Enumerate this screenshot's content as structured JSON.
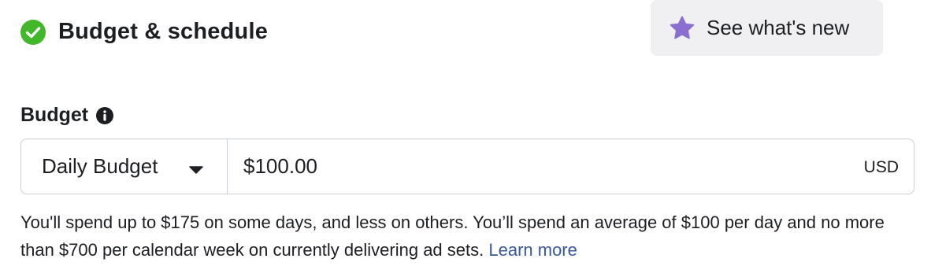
{
  "section": {
    "title": "Budget & schedule",
    "status_color": "#42b72a"
  },
  "whats_new": {
    "label": "See what's new",
    "icon": "star-icon",
    "icon_color": "#8a6fd1"
  },
  "budget": {
    "label": "Budget",
    "type_value": "Daily Budget",
    "amount_value": "$100.00",
    "currency": "USD"
  },
  "help": {
    "text": "You'll spend up to $175 on some days, and less on others. You’ll spend an average of $100 per day and no more than $700 per calendar week on currently delivering ad sets. ",
    "link": "Learn more",
    "link_color": "#385898"
  }
}
